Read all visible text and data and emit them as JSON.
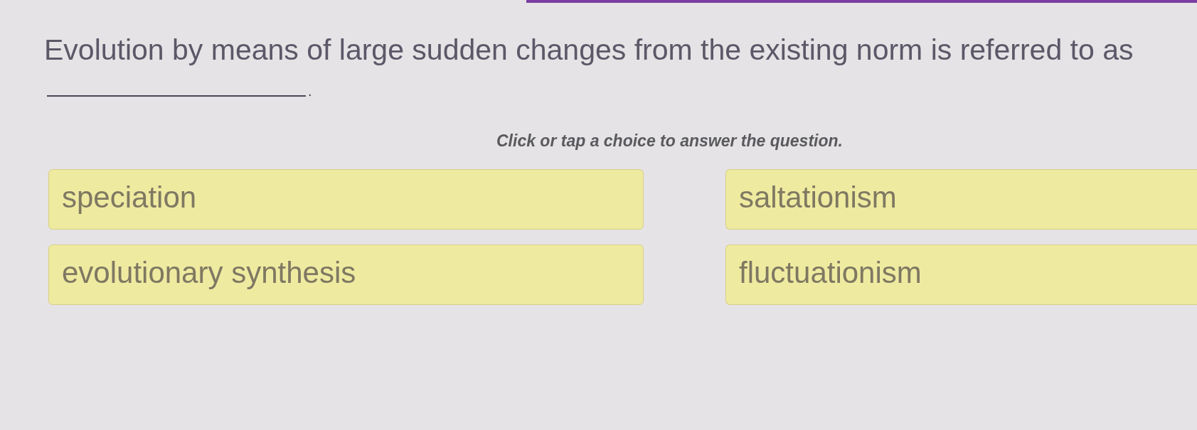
{
  "question": {
    "text": "Evolution by means of large sudden changes from the existing norm is referred to as",
    "ending": "."
  },
  "instruction": "Click or tap a choice to answer the question.",
  "choices": [
    {
      "label": "speciation",
      "selected": false
    },
    {
      "label": "saltationism",
      "selected": false
    },
    {
      "label": "evolutionary synthesis",
      "selected": false
    },
    {
      "label": "fluctuationism",
      "selected": false
    }
  ]
}
